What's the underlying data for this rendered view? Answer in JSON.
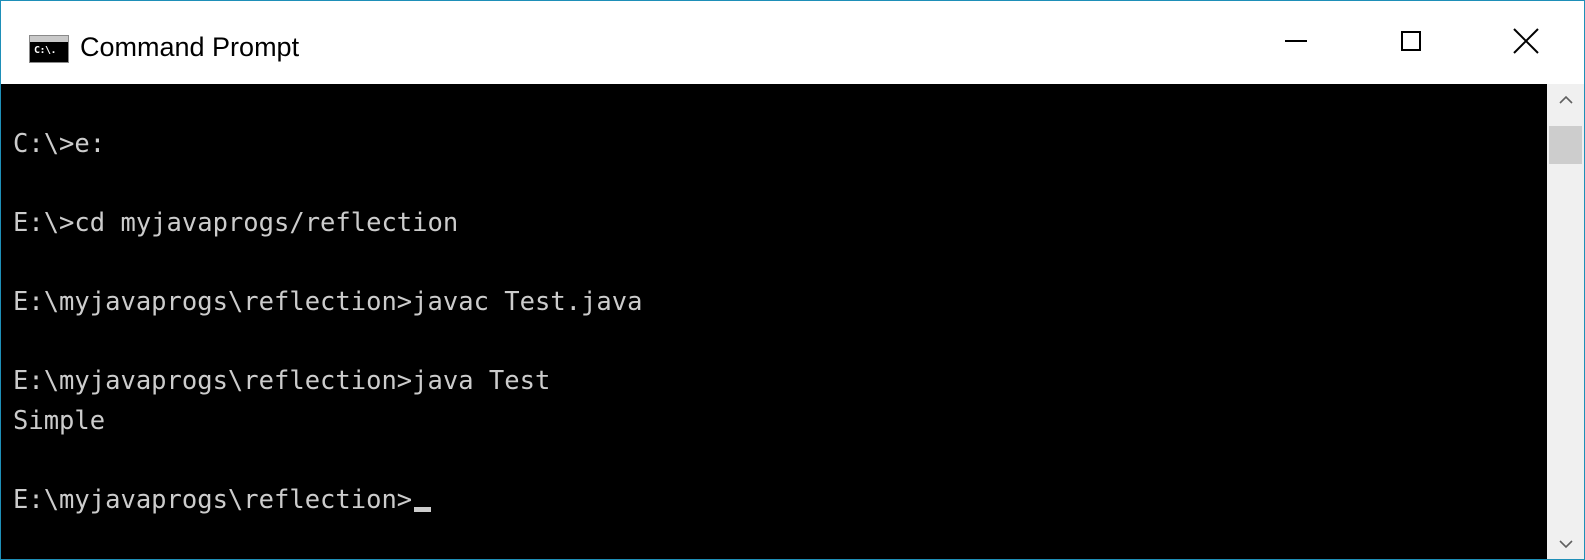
{
  "window": {
    "title": "Command Prompt",
    "app_icon_label": "C:\\.",
    "accent_color": "#1e8fb8"
  },
  "title_buttons": {
    "minimize_icon": "minimize-icon",
    "maximize_icon": "maximize-icon",
    "close_icon": "close-icon"
  },
  "console": {
    "background": "#000000",
    "foreground": "#cccccc",
    "lines": [
      "C:\\>e:",
      "",
      "E:\\>cd myjavaprogs/reflection",
      "",
      "E:\\myjavaprogs\\reflection>javac Test.java",
      "",
      "E:\\myjavaprogs\\reflection>java Test",
      "Simple",
      "",
      "E:\\myjavaprogs\\reflection>"
    ]
  },
  "scrollbar": {
    "up_icon": "chevron-up-icon",
    "down_icon": "chevron-down-icon"
  }
}
